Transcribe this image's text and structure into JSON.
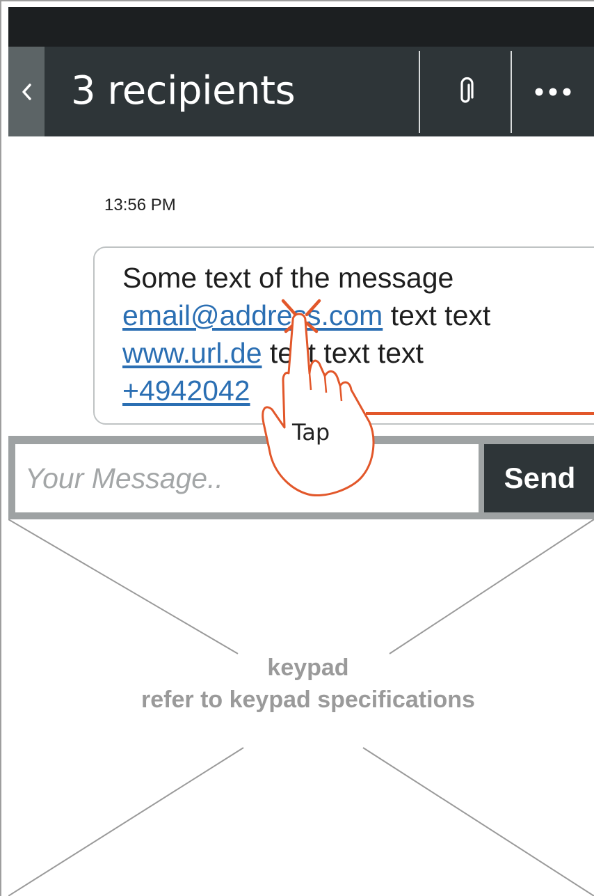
{
  "header": {
    "back_icon": "chevron-left-icon",
    "title": "3 recipients",
    "attach_icon": "paperclip-icon",
    "more_icon": "more-horizontal-icon"
  },
  "message": {
    "timestamp": "13:56 PM",
    "line1": "Some text of the message",
    "email": "email@address.com",
    "email_suffix": " text text",
    "url": "www.url.de",
    "url_suffix": " text text text",
    "phone": "+4942042"
  },
  "compose": {
    "placeholder": "Your Message..",
    "send_label": "Send"
  },
  "keypad": {
    "title": "keypad",
    "subtitle": "refer to keypad specifications"
  },
  "annotation": {
    "gesture_icon": "tap-hand-icon",
    "label": "Tap"
  },
  "colors": {
    "header_bg": "#2e3538",
    "status_bg": "#1c1f21",
    "back_bg": "#5c6466",
    "link": "#2b6fb3",
    "annotation": "#e2572a",
    "compose_bg": "#9ea2a3"
  }
}
